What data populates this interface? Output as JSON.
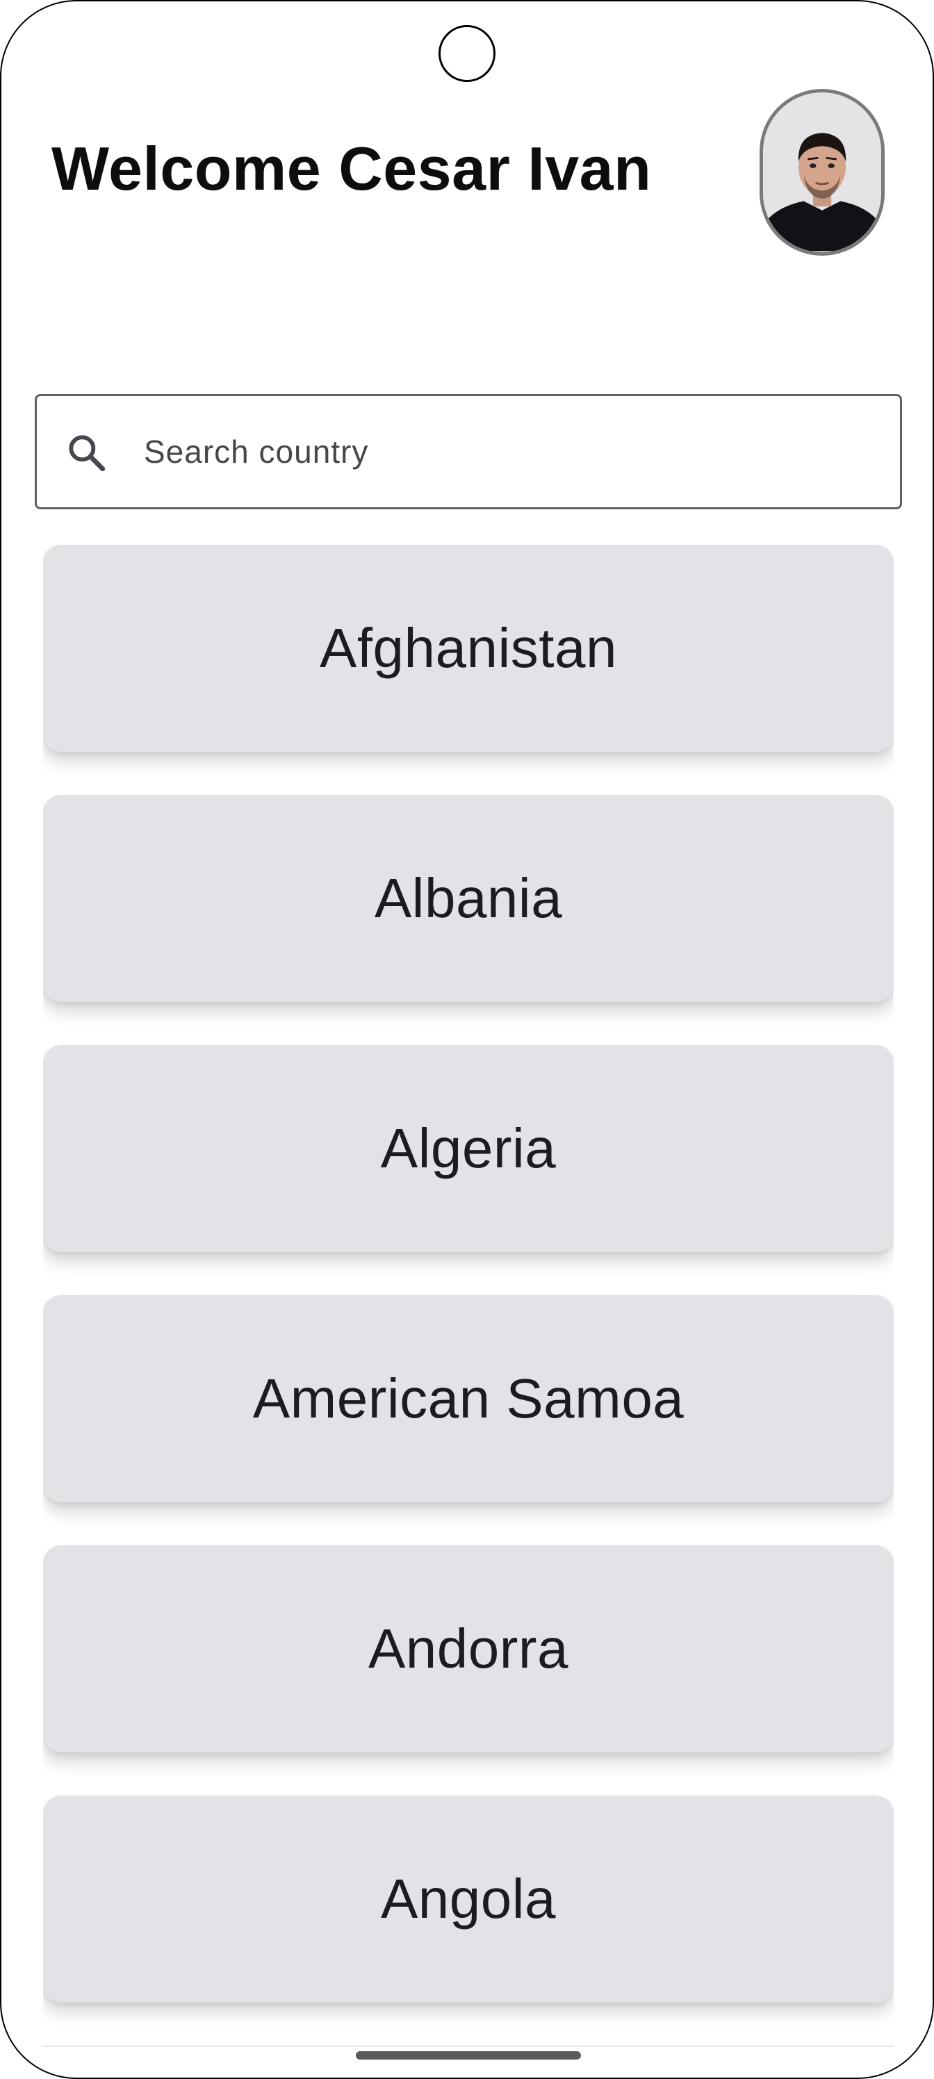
{
  "header": {
    "title": "Welcome Cesar Ivan",
    "avatar_icon": "user-avatar-photo"
  },
  "search": {
    "placeholder": "Search country",
    "value": "",
    "icon": "search-icon"
  },
  "countries": [
    {
      "name": "Afghanistan"
    },
    {
      "name": "Albania"
    },
    {
      "name": "Algeria"
    },
    {
      "name": "American Samoa"
    },
    {
      "name": "Andorra"
    },
    {
      "name": "Angola"
    }
  ],
  "colors": {
    "card_background": "#e2e2e7",
    "card_text": "#1c1b22",
    "search_border": "#5f5f66",
    "title_text": "#0d0d0d"
  }
}
